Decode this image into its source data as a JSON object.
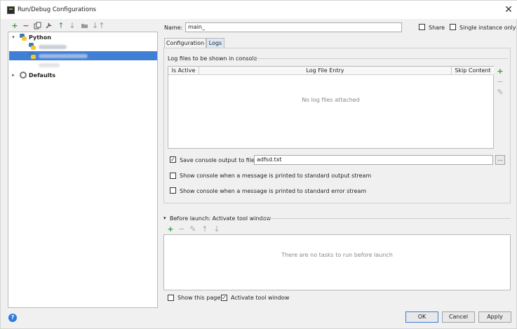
{
  "window": {
    "title": "Run/Debug Configurations",
    "close_glyph": "✕"
  },
  "toolbar_left": {
    "icons": [
      "add-icon",
      "remove-icon",
      "copy-icon",
      "wrench-icon",
      "move-up-icon",
      "move-down-icon",
      "folder-icon",
      "sort-icon"
    ]
  },
  "tree": {
    "python_label": "Python",
    "defaults_label": "Defaults"
  },
  "config": {
    "name_label": "Name:",
    "name_value": "main_",
    "share_label": "Share",
    "single_instance_label": "Single instance only"
  },
  "tabs": [
    {
      "label": "Configuration",
      "active": false
    },
    {
      "label": "Logs",
      "active": true
    }
  ],
  "logs": {
    "section_title": "Log files to be shown in console",
    "columns": [
      "Is Active",
      "Log File Entry",
      "Skip Content"
    ],
    "empty_text": "No log files attached",
    "save_output_label": "Save console output to file:",
    "save_output_checked": true,
    "save_output_path": "adfsd.txt",
    "browse_label": "...",
    "show_stdout_label": "Show console when a message is printed to standard output stream",
    "show_stderr_label": "Show console when a message is printed to standard error stream"
  },
  "before_launch": {
    "title": "Before launch: Activate tool window",
    "empty_text": "There are no tasks to run before launch"
  },
  "footer": {
    "show_page_label": "Show this page",
    "show_page_checked": false,
    "activate_tool_label": "Activate tool window",
    "activate_tool_checked": true,
    "help_glyph": "?",
    "ok_label": "OK",
    "cancel_label": "Cancel",
    "apply_label": "Apply"
  },
  "colors": {
    "selection": "#3f7fd6",
    "accent_green": "#3c9a3c",
    "accent_red": "#d03b3b"
  }
}
